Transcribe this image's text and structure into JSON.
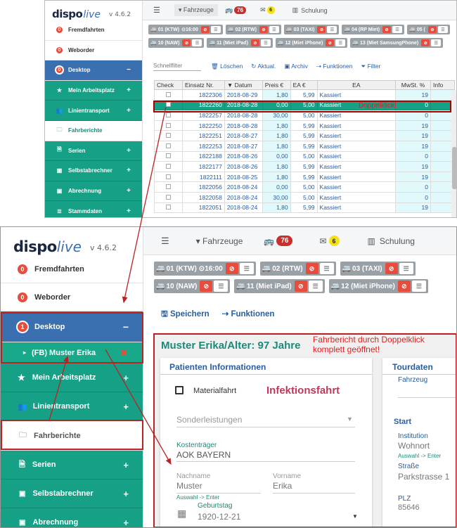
{
  "app": {
    "logo_part1": "dispo",
    "logo_part2": "live",
    "version": "v 4.6.2"
  },
  "top_panel": {
    "sidebar": [
      {
        "badge": "0",
        "label": "Fremdfahrten",
        "style": "white"
      },
      {
        "badge": "0",
        "label": "Weborder",
        "style": "white"
      },
      {
        "badge": "0",
        "label": "Desktop",
        "style": "blue",
        "action": "−"
      },
      {
        "icon": "star-icon",
        "label": "Mein Arbeitsplatz",
        "style": "green",
        "action": "+"
      },
      {
        "icon": "users-icon",
        "label": "Linientransport",
        "style": "green",
        "action": "+"
      },
      {
        "icon": "folder-icon",
        "label": "Fahrberichte",
        "style": "white-green"
      },
      {
        "icon": "file-icon",
        "label": "Serien",
        "style": "green",
        "action": "+"
      },
      {
        "icon": "money-icon",
        "label": "Selbstabrechner",
        "style": "green",
        "action": "+"
      },
      {
        "icon": "money-icon",
        "label": "Abrechnung",
        "style": "green",
        "action": "+"
      },
      {
        "icon": "database-icon",
        "label": "Stammdaten",
        "style": "green",
        "action": "+"
      }
    ],
    "topbar": {
      "menu_icon": "list-icon",
      "fahrzeuge": "Fahrzeuge",
      "bus_count": "76",
      "mail_count": "6",
      "schulung": "Schulung"
    },
    "vehicles_row1": [
      "01 (KTW)",
      "02 (RTW)",
      "03 (TAXI)",
      "04 (RP Miet)",
      "05 ("
    ],
    "vehicle_time": "16:00",
    "vehicles_row2": [
      "10 (NAW)",
      "11 (Miet iPad)",
      "12 (Miet iPhone)",
      "13 (Miet SamsungPhone)"
    ],
    "toolbar": {
      "filter_placeholder": "Schnellfilter",
      "delete": "Löschen",
      "refresh": "Aktual.",
      "archive": "Archiv",
      "functions": "Funktionen",
      "filter": "Filter"
    },
    "table": {
      "headers": [
        "Check",
        "Einsatz Nr.",
        "▼ Datum",
        "Preis €",
        "EA €",
        "EA",
        "MwSt. %",
        "Info"
      ],
      "rows": [
        {
          "nr": "1822306",
          "date": "2018-08-29",
          "price": "1,80",
          "ea_eur": "5,99",
          "ea": "Kassiert",
          "mwst": "19"
        },
        {
          "nr": "1822260",
          "date": "2018-08-28",
          "price": "0,00",
          "ea_eur": "5,00",
          "ea": "Kassiert",
          "mwst": "0",
          "selected": true
        },
        {
          "nr": "1822257",
          "date": "2018-08-28",
          "price": "30,00",
          "ea_eur": "5,00",
          "ea": "Kassiert",
          "mwst": "0"
        },
        {
          "nr": "1822250",
          "date": "2018-08-28",
          "price": "1,80",
          "ea_eur": "5,99",
          "ea": "Kassiert",
          "mwst": "19"
        },
        {
          "nr": "1822251",
          "date": "2018-08-27",
          "price": "1,80",
          "ea_eur": "5,99",
          "ea": "Kassiert",
          "mwst": "19"
        },
        {
          "nr": "1822253",
          "date": "2018-08-27",
          "price": "1,80",
          "ea_eur": "5,99",
          "ea": "Kassiert",
          "mwst": "19"
        },
        {
          "nr": "1822188",
          "date": "2018-08-26",
          "price": "0,00",
          "ea_eur": "5,00",
          "ea": "Kassiert",
          "mwst": "0"
        },
        {
          "nr": "1822177",
          "date": "2018-08-26",
          "price": "1,80",
          "ea_eur": "5,99",
          "ea": "Kassiert",
          "mwst": "19"
        },
        {
          "nr": "1822111",
          "date": "2018-08-25",
          "price": "1,80",
          "ea_eur": "5,99",
          "ea": "Kassiert",
          "mwst": "19"
        },
        {
          "nr": "1822056",
          "date": "2018-08-24",
          "price": "0,00",
          "ea_eur": "5,00",
          "ea": "Kassiert",
          "mwst": "0"
        },
        {
          "nr": "1822058",
          "date": "2018-08-24",
          "price": "30,00",
          "ea_eur": "5,00",
          "ea": "Kassiert",
          "mwst": "0"
        },
        {
          "nr": "1822051",
          "date": "2018-08-24",
          "price": "1,80",
          "ea_eur": "5,99",
          "ea": "Kassiert",
          "mwst": "19"
        }
      ]
    },
    "annotation": "Doppelklick!"
  },
  "bottom_panel": {
    "sidebar": {
      "fremdfahrten": {
        "badge": "0",
        "label": "Fremdfahrten"
      },
      "weborder": {
        "badge": "0",
        "label": "Weborder"
      },
      "desktop": {
        "badge": "1",
        "label": "Desktop",
        "action": "−"
      },
      "sub_item": {
        "label": "(FB) Muster Erika",
        "close": "✖"
      },
      "arbeitsplatz": {
        "label": "Mein Arbeitsplatz",
        "action": "+"
      },
      "linien": {
        "label": "Linientransport",
        "action": "+"
      },
      "fahrberichte": {
        "label": "Fahrberichte"
      },
      "serien": {
        "label": "Serien",
        "action": "+"
      },
      "selbst": {
        "label": "Selbstabrechner",
        "action": "+"
      },
      "abrechnung": {
        "label": "Abrechnung",
        "action": "+"
      }
    },
    "topbar": {
      "fahrzeuge": "Fahrzeuge",
      "bus_count": "76",
      "mail_count": "6",
      "schulung": "Schulung"
    },
    "vehicles_row1": [
      "01 (KTW)",
      "02 (RTW)",
      "03 (TAXI)"
    ],
    "vehicle_time": "16:00",
    "vehicles_row2": [
      "10 (NAW)",
      "11 (Miet iPad)",
      "12 (Miet iPhone)"
    ],
    "actions": {
      "save": "Speichern",
      "functions": "Funktionen"
    },
    "form": {
      "title": "Muster Erika/Alter: 97 Jahre",
      "patient_header": "Patienten Informationen",
      "tour_header": "Tourdaten",
      "materialfahrt": "Materialfahrt",
      "infektion": "Infektionsfahrt",
      "sonderleistungen": "Sonderleistungen",
      "kostentraeger_label": "Kostenträger",
      "kostentraeger_value": "AOK BAYERN",
      "nachname_label": "Nachname",
      "nachname_value": "Muster",
      "vorname_label": "Vorname",
      "vorname_value": "Erika",
      "auswahl_hint": "Auswahl -> Enter",
      "geburtstag_label": "Geburtstag",
      "geburtstag_value": "1920-12-21",
      "fahrzeug_label": "Fahrzeug",
      "start_label": "Start",
      "institution_label": "Institution",
      "institution_value": "Wohnort",
      "strasse_label": "Straße",
      "strasse_value": "Parkstrasse 1",
      "plz_label": "PLZ",
      "plz_value": "85646"
    },
    "annotation": "Fahrbericht durch Doppelklick komplett geöffnet!"
  },
  "colors": {
    "green": "#16a085",
    "blue": "#3a6fb0",
    "red_annotation": "#d22",
    "badge_red": "#e74c3c"
  }
}
